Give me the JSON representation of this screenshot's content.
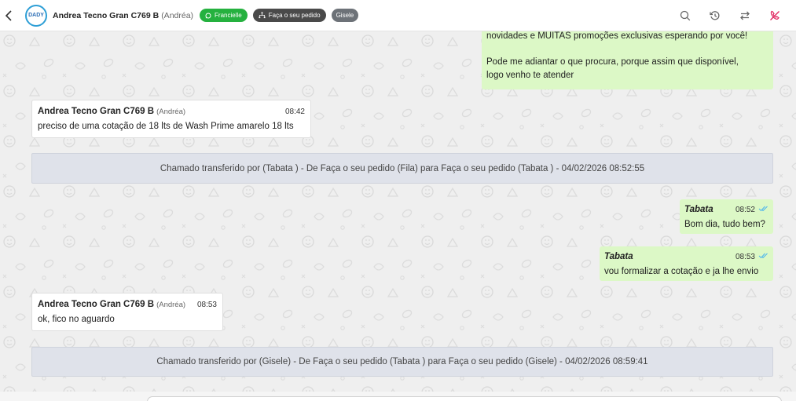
{
  "header": {
    "contact_name": "Andrea Tecno Gran C769 B",
    "contact_sub": "(Andréa)",
    "avatar_text": "DADY",
    "tags": [
      "Francielle",
      "Faça o seu pedido",
      "Gisele"
    ],
    "icons": [
      "back-icon",
      "search-icon",
      "history-icon",
      "transfer-icon",
      "end-chat-icon"
    ],
    "colors": {
      "green_tag": "#25b13f",
      "dark_tag": "#4a4a4a",
      "gray_tag": "#6d7278",
      "end_icon": "#e0245e"
    }
  },
  "messages": {
    "greeting_line1": "novidades e MUITAS promoções exclusivas esperando por você!",
    "greeting_line2": "Pode me adiantar o que procura, porque assim que disponível,",
    "greeting_line3": "logo venho te atender",
    "msg1": {
      "sender": "Andrea Tecno Gran C769 B",
      "sender_sub": "(Andréa)",
      "time": "08:42",
      "text": "preciso de uma cotação de 18 lts de Wash Prime amarelo 18 lts"
    },
    "system1": "Chamado transferido por (Tabata ) - De Faça o seu pedido (Fila) para Faça o seu pedido (Tabata ) - 04/02/2026 08:52:55",
    "msg2": {
      "sender": "Tabata",
      "time": "08:52",
      "text": "Bom dia, tudo bem?"
    },
    "msg3": {
      "sender": "Tabata",
      "time": "08:53",
      "text": "vou formalizar a cotação e ja lhe envio"
    },
    "msg4": {
      "sender": "Andrea Tecno Gran C769 B",
      "sender_sub": "(Andréa)",
      "time": "08:53",
      "text": "ok, fico no aguardo"
    },
    "system2": "Chamado transferido por (Gisele) - De Faça o seu pedido (Tabata ) para Faça o seu pedido (Gisele) - 04/02/2026 08:59:41"
  },
  "colors": {
    "incoming_bg": "#ffffff",
    "outgoing_bg": "#dcf8c6",
    "system_bg": "#dfe2ea",
    "read_check": "#4fb6ec"
  }
}
